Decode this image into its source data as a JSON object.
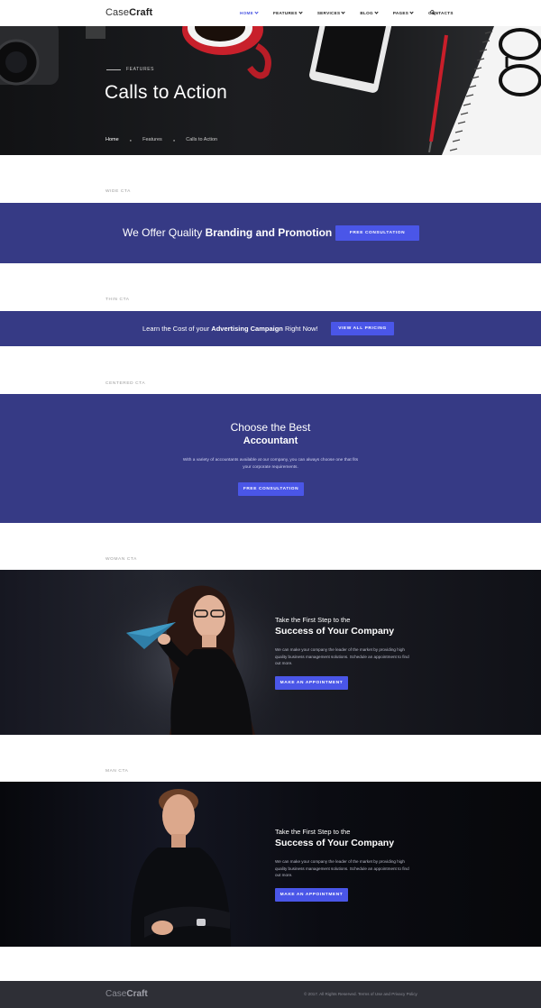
{
  "header": {
    "logo_light": "Case",
    "logo_bold": "Craft",
    "nav": [
      {
        "label": "HOME",
        "dropdown": true
      },
      {
        "label": "FEATURES",
        "dropdown": true
      },
      {
        "label": "SERVICES",
        "dropdown": true
      },
      {
        "label": "BLOG",
        "dropdown": true
      },
      {
        "label": "PAGES",
        "dropdown": true
      },
      {
        "label": "CONTACTS",
        "dropdown": false
      }
    ],
    "search_icon": "search-icon"
  },
  "hero": {
    "eyebrow": "FEATURES",
    "title": "Calls to Action",
    "breadcrumb": [
      "Home",
      "Features",
      "Calls to Action"
    ]
  },
  "sections": {
    "wide": {
      "label": "WIDE CTA",
      "text_light": "We Offer Quality ",
      "text_bold": "Branding and Promotion",
      "button": "FREE CONSULTATION"
    },
    "thin": {
      "label": "THIN CTA",
      "text_pre": "Learn the Cost of your ",
      "text_bold": "Advertising Campaign",
      "text_post": " Right Now!",
      "button": "VIEW ALL PRICING"
    },
    "centered": {
      "label": "CENTERED CTA",
      "line1": "Choose the Best",
      "line2": "Accountant",
      "desc": "With a variety of accountants available at our company, you can always choose one that fits your corporate requirements.",
      "button": "FREE CONSULTATION"
    },
    "woman": {
      "label": "WOMAN CTA",
      "line1": "Take the First Step to the",
      "line2": "Success of Your Company",
      "desc": "We can make your company the leader of the market by providing high quality business management solutions. Schedule an appointment to find out more.",
      "button": "MAKE AN APPOINTMENT"
    },
    "man": {
      "label": "MAN CTA",
      "line1": "Take the First Step to the",
      "line2": "Success of Your Company",
      "desc": "We can make your company the leader of the market by providing high quality business management solutions. Schedule an appointment to find out more.",
      "button": "MAKE AN APPOINTMENT"
    }
  },
  "footer": {
    "logo_light": "Case",
    "logo_bold": "Craft",
    "copyright": "© 2017. All Rights Reserved. Terms of Use and Privacy Policy"
  },
  "colors": {
    "accent": "#4a56e8",
    "band": "#363a85",
    "footer": "#2e2f36"
  }
}
